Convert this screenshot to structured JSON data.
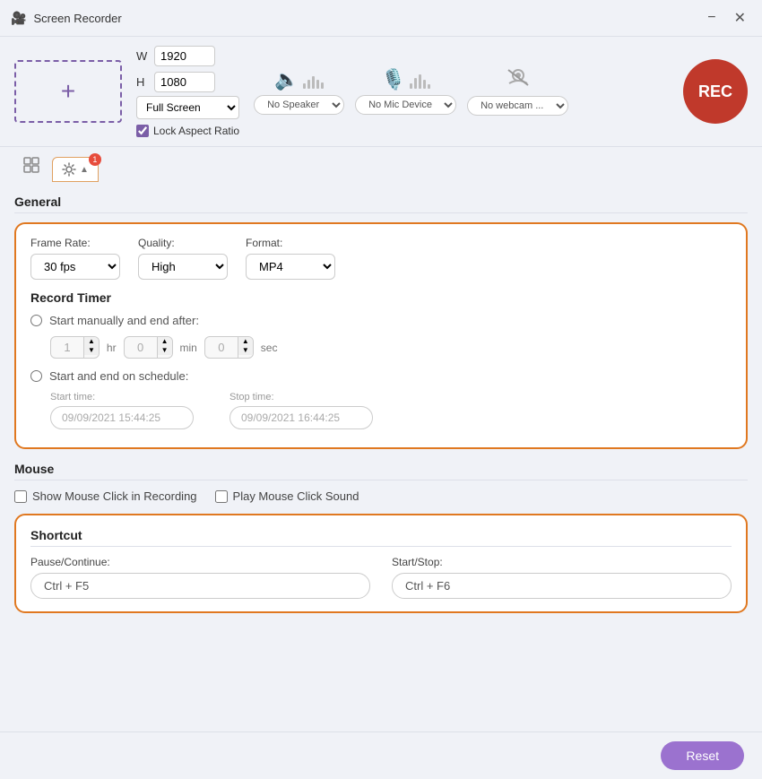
{
  "titleBar": {
    "title": "Screen Recorder",
    "minimizeLabel": "−",
    "closeLabel": "✕"
  },
  "toolbar": {
    "plusLabel": "+",
    "widthLabel": "W",
    "heightLabel": "H",
    "widthValue": "1920",
    "heightValue": "1080",
    "fullScreenLabel": "Full Screen",
    "lockAspectLabel": "Lock Aspect Ratio",
    "speakerLabel": "No Speaker",
    "micLabel": "No Mic Device",
    "webcamLabel": "No webcam ...",
    "recLabel": "REC"
  },
  "tabs": {
    "badge": "1"
  },
  "general": {
    "sectionTitle": "General",
    "frameRateLabel": "Frame Rate:",
    "frameRateValue": "30 fps",
    "qualityLabel": "Quality:",
    "qualityValue": "High",
    "formatLabel": "Format:",
    "formatValue": "MP4"
  },
  "recordTimer": {
    "title": "Record Timer",
    "option1Label": "Start manually and end after:",
    "hrValue": "1",
    "hrUnit": "hr",
    "minValue": "0",
    "minUnit": "min",
    "secValue": "0",
    "secUnit": "sec",
    "option2Label": "Start and end on schedule:",
    "startTimeLabel": "Start time:",
    "startTimeValue": "09/09/2021 15:44:25",
    "stopTimeLabel": "Stop time:",
    "stopTimeValue": "09/09/2021 16:44:25"
  },
  "mouse": {
    "sectionTitle": "Mouse",
    "showClickLabel": "Show Mouse Click in Recording",
    "playClickSoundLabel": "Play Mouse Click Sound"
  },
  "shortcut": {
    "sectionTitle": "Shortcut",
    "pauseLabel": "Pause/Continue:",
    "pauseValue": "Ctrl + F5",
    "startStopLabel": "Start/Stop:",
    "startStopValue": "Ctrl + F6"
  },
  "footer": {
    "resetLabel": "Reset"
  }
}
